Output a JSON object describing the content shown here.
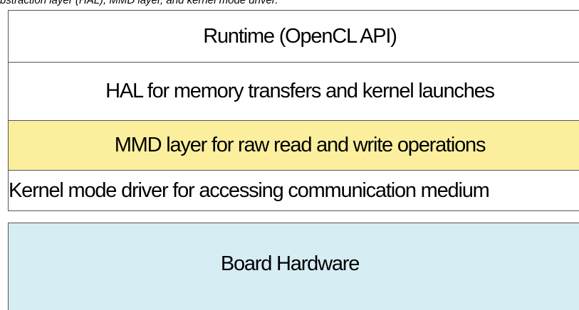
{
  "caption": "bstraction layer (HAL), MMD layer, and kernel mode driver.",
  "software_stack": {
    "layers": [
      {
        "label": "Runtime (OpenCL API)"
      },
      {
        "label": "HAL for memory transfers and kernel launches"
      },
      {
        "label": "MMD layer for raw read and write operations",
        "fill": "#fbef9e"
      },
      {
        "label": "Kernel mode driver for accessing communication medium"
      }
    ]
  },
  "hardware": {
    "label": "Board Hardware",
    "fill": "#d6edf4"
  }
}
